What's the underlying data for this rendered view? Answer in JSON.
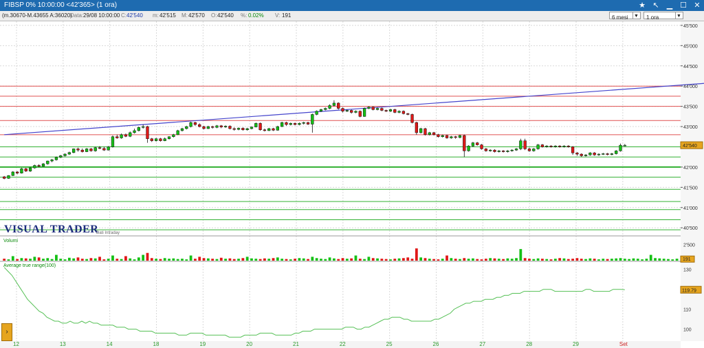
{
  "window": {
    "title": "FIBSP 0%  10:00:00  <42'365>  (1 ora)"
  },
  "infobar": {
    "ma": "(m.30670-M.43655 A:36020)",
    "data_label": "Data:",
    "data_value": "29/08 10:00:00",
    "c_label": "C:",
    "c_value": "42'540",
    "m_label": "m:",
    "m_value": "42'515",
    "mx_label": "M:",
    "mx_value": "42'570",
    "o_label": "O:",
    "o_value": "42'540",
    "pct_label": "%:",
    "pct_value": "0.02%",
    "v_label": "V:",
    "v_value": "191",
    "period": "6 mesi",
    "timeframe": "1 ora"
  },
  "brand": {
    "logo": "VISUAL TRADER",
    "sub": "Dati Intraday"
  },
  "panels": {
    "volume_title": "Volumi",
    "atr_title": "Average true range(100)"
  },
  "price_axis": {
    "ticks": [
      {
        "v": 45500,
        "t": "45'500"
      },
      {
        "v": 45000,
        "t": "45'000"
      },
      {
        "v": 44500,
        "t": "44'500"
      },
      {
        "v": 44000,
        "t": "44'000"
      },
      {
        "v": 43500,
        "t": "43'500"
      },
      {
        "v": 43000,
        "t": "43'000"
      },
      {
        "v": 42000,
        "t": "42'000"
      },
      {
        "v": 41500,
        "t": "41'500"
      },
      {
        "v": 41000,
        "t": "41'000"
      },
      {
        "v": 40500,
        "t": "40'500"
      }
    ],
    "last_label": "42'540",
    "last_value": 42540
  },
  "volume_axis": {
    "tick": "2'500",
    "tick_value": 2500,
    "last_label": "191",
    "last_value": 191
  },
  "atr_axis": {
    "ticks": [
      {
        "v": 130,
        "t": "130"
      },
      {
        "v": 120,
        "t": "120"
      },
      {
        "v": 110,
        "t": "110"
      },
      {
        "v": 100,
        "t": "100"
      }
    ],
    "last_label": "119.79",
    "last_value": 119.79
  },
  "x_labels": [
    "12",
    "13",
    "14",
    "18",
    "19",
    "20",
    "21",
    "22",
    "25",
    "26",
    "27",
    "28",
    "29",
    "Set"
  ],
  "colors": {
    "up": "#16c016",
    "down": "#e01818",
    "trend": "#4444cc",
    "resistance": "#e05050",
    "support": "#30b030",
    "atr": "#55c055",
    "title_bar": "#1e6bb0"
  },
  "chart_data": {
    "type": "candlestick",
    "candles": [
      [
        41760,
        41720,
        41780,
        41700
      ],
      [
        41720,
        41790,
        41800,
        41710
      ],
      [
        41790,
        41880,
        41900,
        41780
      ],
      [
        41880,
        41850,
        41900,
        41820
      ],
      [
        41850,
        41960,
        41980,
        41840
      ],
      [
        41960,
        41900,
        41980,
        41880
      ],
      [
        41900,
        41980,
        42000,
        41880
      ],
      [
        41980,
        42040,
        42060,
        41960
      ],
      [
        42040,
        42020,
        42070,
        42000
      ],
      [
        42020,
        42080,
        42100,
        42010
      ],
      [
        42080,
        42150,
        42160,
        42060
      ],
      [
        42150,
        42180,
        42200,
        42120
      ],
      [
        42180,
        42240,
        42260,
        42160
      ],
      [
        42240,
        42280,
        42300,
        42220
      ],
      [
        42280,
        42320,
        42340,
        42260
      ],
      [
        42320,
        42360,
        42380,
        42300
      ],
      [
        42360,
        42450,
        42460,
        42340
      ],
      [
        42450,
        42420,
        42480,
        42380
      ],
      [
        42420,
        42380,
        42460,
        42360
      ],
      [
        42380,
        42450,
        42470,
        42370
      ],
      [
        42450,
        42400,
        42470,
        42380
      ],
      [
        42400,
        42480,
        42500,
        42380
      ],
      [
        42480,
        42460,
        42520,
        42440
      ],
      [
        42460,
        42420,
        42500,
        42400
      ],
      [
        42420,
        42500,
        42520,
        42410
      ],
      [
        42500,
        42750,
        42780,
        42480
      ],
      [
        42750,
        42720,
        42800,
        42700
      ],
      [
        42720,
        42800,
        42830,
        42700
      ],
      [
        42800,
        42760,
        42830,
        42740
      ],
      [
        42760,
        42850,
        42880,
        42740
      ],
      [
        42850,
        42900,
        42950,
        42830
      ],
      [
        42900,
        42980,
        43000,
        42880
      ],
      [
        42980,
        43000,
        43050,
        42950
      ],
      [
        43000,
        42700,
        43020,
        42600
      ],
      [
        42700,
        42650,
        42720,
        42620
      ],
      [
        42650,
        42700,
        42720,
        42630
      ],
      [
        42700,
        42650,
        42720,
        42630
      ],
      [
        42650,
        42700,
        42730,
        42640
      ],
      [
        42700,
        42750,
        42760,
        42680
      ],
      [
        42750,
        42800,
        42820,
        42730
      ],
      [
        42800,
        42900,
        42920,
        42790
      ],
      [
        42900,
        42950,
        42970,
        42880
      ],
      [
        42950,
        43000,
        43020,
        42930
      ],
      [
        43000,
        43100,
        43120,
        42980
      ],
      [
        43100,
        43050,
        43120,
        43020
      ],
      [
        43050,
        43000,
        43080,
        42980
      ],
      [
        43000,
        42950,
        43020,
        42930
      ],
      [
        42950,
        43000,
        43020,
        42940
      ],
      [
        43000,
        42980,
        43020,
        42950
      ],
      [
        42980,
        43020,
        43040,
        42960
      ],
      [
        43020,
        42990,
        43040,
        42960
      ],
      [
        42990,
        43010,
        43030,
        42970
      ],
      [
        43010,
        42950,
        43030,
        42930
      ],
      [
        42950,
        42930,
        42980,
        42900
      ],
      [
        42930,
        42960,
        42980,
        42910
      ],
      [
        42960,
        42920,
        42980,
        42900
      ],
      [
        42920,
        42950,
        42970,
        42900
      ],
      [
        42950,
        42990,
        43000,
        42930
      ],
      [
        42990,
        43080,
        43100,
        42980
      ],
      [
        43080,
        42920,
        43100,
        42900
      ],
      [
        42920,
        42900,
        42950,
        42880
      ],
      [
        42900,
        42950,
        42970,
        42890
      ],
      [
        42950,
        42910,
        42970,
        42890
      ],
      [
        42910,
        43000,
        43020,
        42900
      ],
      [
        43000,
        43100,
        43120,
        42990
      ],
      [
        43100,
        43050,
        43120,
        43020
      ],
      [
        43050,
        43080,
        43100,
        43030
      ],
      [
        43080,
        43050,
        43100,
        43030
      ],
      [
        43050,
        43080,
        43100,
        43030
      ],
      [
        43080,
        43100,
        43120,
        43050
      ],
      [
        43100,
        43060,
        43120,
        43040
      ],
      [
        43060,
        43300,
        43320,
        42850
      ],
      [
        43300,
        43380,
        43400,
        43280
      ],
      [
        43380,
        43420,
        43440,
        43360
      ],
      [
        43420,
        43450,
        43470,
        43400
      ],
      [
        43450,
        43520,
        43550,
        43430
      ],
      [
        43520,
        43580,
        43650,
        43500
      ],
      [
        43580,
        43450,
        43600,
        43420
      ],
      [
        43450,
        43380,
        43470,
        43350
      ],
      [
        43380,
        43400,
        43420,
        43360
      ],
      [
        43400,
        43350,
        43420,
        43320
      ],
      [
        43350,
        43380,
        43400,
        43330
      ],
      [
        43380,
        43250,
        43400,
        43230
      ],
      [
        43250,
        43450,
        43470,
        43240
      ],
      [
        43450,
        43480,
        43500,
        43430
      ],
      [
        43480,
        43420,
        43500,
        43400
      ],
      [
        43420,
        43450,
        43470,
        43400
      ],
      [
        43450,
        43400,
        43470,
        43380
      ],
      [
        43400,
        43380,
        43420,
        43360
      ],
      [
        43380,
        43420,
        43440,
        43360
      ],
      [
        43420,
        43350,
        43440,
        43330
      ],
      [
        43350,
        43380,
        43400,
        43330
      ],
      [
        43380,
        43320,
        43400,
        43300
      ],
      [
        43320,
        43300,
        43340,
        43280
      ],
      [
        43300,
        43100,
        43320,
        43080
      ],
      [
        43100,
        42850,
        43120,
        42800
      ],
      [
        42850,
        42950,
        42970,
        42830
      ],
      [
        42950,
        42800,
        42970,
        42780
      ],
      [
        42800,
        42850,
        42870,
        42780
      ],
      [
        42850,
        42800,
        42870,
        42780
      ],
      [
        42800,
        42750,
        42820,
        42730
      ],
      [
        42750,
        42780,
        42800,
        42730
      ],
      [
        42780,
        42720,
        42800,
        42700
      ],
      [
        42720,
        42750,
        42770,
        42700
      ],
      [
        42750,
        42730,
        42770,
        42700
      ],
      [
        42730,
        42780,
        42800,
        42710
      ],
      [
        42780,
        42400,
        42800,
        42250
      ],
      [
        42400,
        42520,
        42540,
        42380
      ],
      [
        42520,
        42600,
        42620,
        42500
      ],
      [
        42600,
        42550,
        42620,
        42530
      ],
      [
        42550,
        42450,
        42570,
        42430
      ],
      [
        42450,
        42400,
        42470,
        42380
      ],
      [
        42400,
        42420,
        42440,
        42380
      ],
      [
        42420,
        42380,
        42440,
        42360
      ],
      [
        42380,
        42400,
        42420,
        42360
      ],
      [
        42400,
        42380,
        42420,
        42360
      ],
      [
        42380,
        42400,
        42420,
        42360
      ],
      [
        42400,
        42420,
        42440,
        42380
      ],
      [
        42420,
        42450,
        42470,
        42400
      ],
      [
        42450,
        42650,
        42700,
        42420
      ],
      [
        42650,
        42450,
        42700,
        42420
      ],
      [
        42450,
        42400,
        42480,
        42380
      ],
      [
        42400,
        42450,
        42470,
        42380
      ],
      [
        42450,
        42550,
        42570,
        42430
      ],
      [
        42550,
        42500,
        42570,
        42480
      ],
      [
        42500,
        42520,
        42540,
        42480
      ],
      [
        42520,
        42500,
        42540,
        42480
      ],
      [
        42500,
        42520,
        42540,
        42480
      ],
      [
        42520,
        42500,
        42540,
        42480
      ],
      [
        42500,
        42520,
        42540,
        42480
      ],
      [
        42520,
        42500,
        42540,
        42480
      ],
      [
        42500,
        42350,
        42520,
        42300
      ],
      [
        42350,
        42320,
        42370,
        42280
      ],
      [
        42320,
        42280,
        42340,
        42250
      ],
      [
        42280,
        42300,
        42320,
        42260
      ],
      [
        42300,
        42350,
        42370,
        42280
      ],
      [
        42350,
        42300,
        42370,
        42280
      ],
      [
        42300,
        42320,
        42340,
        42280
      ],
      [
        42320,
        42330,
        42350,
        42300
      ],
      [
        42330,
        42310,
        42350,
        42290
      ],
      [
        42310,
        42330,
        42350,
        42290
      ],
      [
        42330,
        42400,
        42420,
        42310
      ],
      [
        42400,
        42540,
        42580,
        42380
      ],
      [
        42540,
        42540,
        42570,
        42515
      ]
    ],
    "trendlines": [
      {
        "from": [
          0,
          42800
        ],
        "to": [
          168,
          44120
        ],
        "color": "#4444cc"
      }
    ],
    "resistance_levels": [
      44000,
      43750,
      43500,
      43150,
      42800
    ],
    "support_levels": [
      42500,
      42250,
      42000,
      41750,
      41450,
      41150,
      40950,
      40700,
      40450
    ],
    "price_ylim": [
      40300,
      45600
    ],
    "volumes": [
      300,
      200,
      700,
      250,
      400,
      350,
      300,
      600,
      500,
      300,
      400,
      250,
      900,
      300,
      200,
      450,
      350,
      500,
      300,
      250,
      400,
      350,
      600,
      200,
      300,
      800,
      300,
      250,
      700,
      350,
      200,
      500,
      900,
      1200,
      400,
      300,
      250,
      400,
      300,
      350,
      250,
      300,
      200,
      800,
      300,
      600,
      400,
      350,
      300,
      250,
      450,
      300,
      350,
      250,
      300,
      400,
      600,
      350,
      300,
      250,
      350,
      300,
      400,
      500,
      300,
      250,
      200,
      300,
      400,
      350,
      250,
      600,
      400,
      300,
      250,
      500,
      350,
      250,
      400,
      300,
      350,
      800,
      300,
      250,
      600,
      400,
      350,
      300,
      250,
      200,
      300,
      350,
      400,
      500,
      300,
      1900,
      500,
      400,
      300,
      250,
      200,
      300,
      800,
      400,
      300,
      250,
      400,
      300,
      350,
      250,
      200,
      300,
      400,
      350,
      300,
      250,
      350,
      300,
      400,
      1800,
      400,
      300,
      250,
      350,
      300,
      250,
      200,
      300,
      400,
      350,
      250,
      300,
      400,
      300,
      250,
      350,
      300,
      200,
      300,
      250,
      300,
      350,
      400,
      300,
      250,
      350,
      300,
      200,
      300,
      900,
      400,
      350,
      300,
      250,
      200,
      300
    ],
    "volume_ylim": [
      0,
      3200
    ],
    "atr": [
      131,
      129,
      127,
      124,
      121,
      118,
      115,
      113,
      111,
      109,
      108,
      106,
      105,
      104,
      104,
      103,
      103,
      104,
      103,
      103,
      104,
      103,
      104,
      103,
      103,
      102,
      102,
      102,
      102,
      101,
      101,
      101,
      100,
      100,
      100,
      99,
      99,
      99,
      99,
      98,
      98,
      98,
      98,
      98,
      98,
      97,
      97,
      97,
      98,
      98,
      98,
      98,
      97,
      97,
      97,
      97,
      97,
      97,
      96,
      96,
      96,
      96,
      97,
      97,
      97,
      97,
      98,
      98,
      98,
      98,
      97,
      97,
      97,
      97,
      97,
      98,
      98,
      99,
      99,
      99,
      100,
      100,
      100,
      100,
      100,
      100,
      100,
      100,
      101,
      101,
      101,
      100,
      100,
      101,
      101,
      102,
      103,
      104,
      105,
      105,
      106,
      106,
      106,
      105,
      105,
      104,
      104,
      104,
      104,
      104,
      104,
      105,
      105,
      106,
      107,
      108,
      110,
      111,
      112,
      113,
      113,
      114,
      114,
      114,
      115,
      115,
      115,
      116,
      116,
      117,
      117,
      118,
      118,
      118,
      119,
      119,
      119,
      119,
      119,
      120,
      120,
      120,
      119,
      119,
      119,
      119,
      119,
      119,
      119,
      119,
      120,
      120,
      119,
      119,
      119,
      119,
      119,
      120,
      120,
      120,
      119.79
    ],
    "atr_ylim": [
      94,
      133
    ]
  }
}
